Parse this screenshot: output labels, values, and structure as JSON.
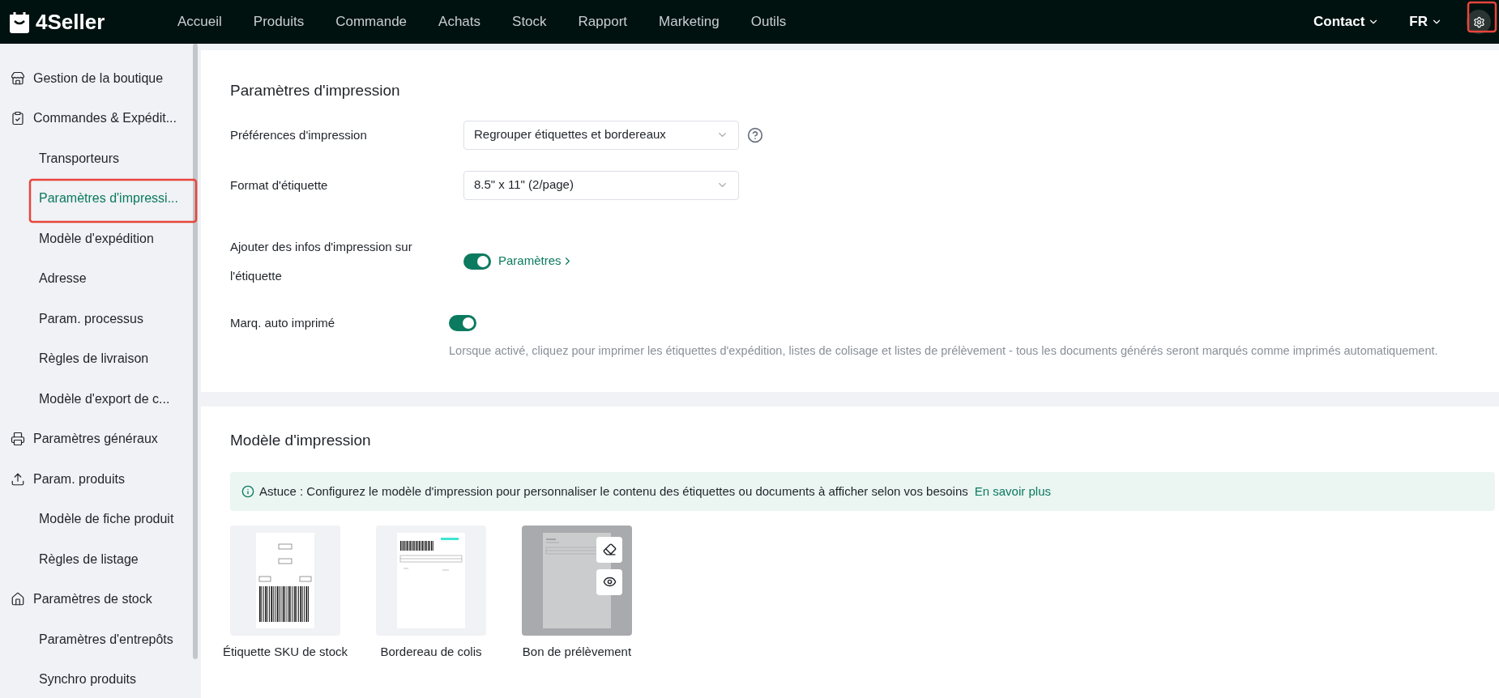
{
  "top_bar": {
    "logo": "4Seller",
    "menu": [
      "Accueil",
      "Produits",
      "Commande",
      "Achats",
      "Stock",
      "Rapport",
      "Marketing",
      "Outils"
    ],
    "contact": "Contact",
    "language": "FR"
  },
  "sidebar": {
    "items": [
      {
        "label": "Gestion de la boutique",
        "selected": false
      },
      {
        "label": "Commandes & Expédit...",
        "selected": false,
        "children": [
          {
            "label": "Transporteurs",
            "selected": false
          },
          {
            "label": "Paramètres d'impressi...",
            "selected": true
          },
          {
            "label": "Modèle d'expédition",
            "selected": false
          },
          {
            "label": "Adresse",
            "selected": false
          },
          {
            "label": "Param. processus",
            "selected": false
          },
          {
            "label": "Règles de livraison",
            "selected": false
          },
          {
            "label": "Modèle d'export de c...",
            "selected": false
          }
        ]
      },
      {
        "label": "Paramètres généraux",
        "selected": false
      },
      {
        "label": "Param. produits",
        "selected": false,
        "children": [
          {
            "label": "Modèle de fiche produit",
            "selected": false
          },
          {
            "label": "Règles de listage",
            "selected": false
          }
        ]
      },
      {
        "label": "Paramètres de stock",
        "selected": false,
        "children": [
          {
            "label": "Paramètres d'entrepôts",
            "selected": false
          },
          {
            "label": "Synchro produits",
            "selected": false
          }
        ]
      }
    ]
  },
  "print_settings": {
    "title": "Paramètres d'impression",
    "rows": [
      {
        "kind": "select",
        "label": "Préférences d'impression",
        "value": "Regrouper étiquettes et bordereaux",
        "help": true
      },
      {
        "kind": "select",
        "label": "Format d'étiquette",
        "value": "8.5\" x 11\" (2/page)",
        "help": false
      },
      {
        "kind": "toggle",
        "label": "Ajouter des infos d'impression sur l'étiquette",
        "on": true,
        "link": "Paramètres"
      },
      {
        "kind": "toggle",
        "label": "Marq. auto imprimé",
        "on": true,
        "description": "Lorsque activé, cliquez pour imprimer les étiquettes d'expédition, listes de colisage et listes de prélèvement - tous les documents générés seront marqués comme imprimés automatiquement."
      }
    ]
  },
  "print_templates": {
    "title": "Modèle d'impression",
    "tip": "Astuce : Configurez le modèle d'impression pour personnaliser le contenu des étiquettes ou documents à afficher selon vos besoins",
    "tip_link": "En savoir plus",
    "templates": [
      {
        "kind": "sku_label",
        "name": "Étiquette SKU de stock",
        "hovered": false
      },
      {
        "kind": "packing_slip",
        "name": "Bordereau de colis",
        "hovered": false
      },
      {
        "kind": "pick_list",
        "name": "Bon de prélèvement",
        "hovered": true
      }
    ]
  }
}
